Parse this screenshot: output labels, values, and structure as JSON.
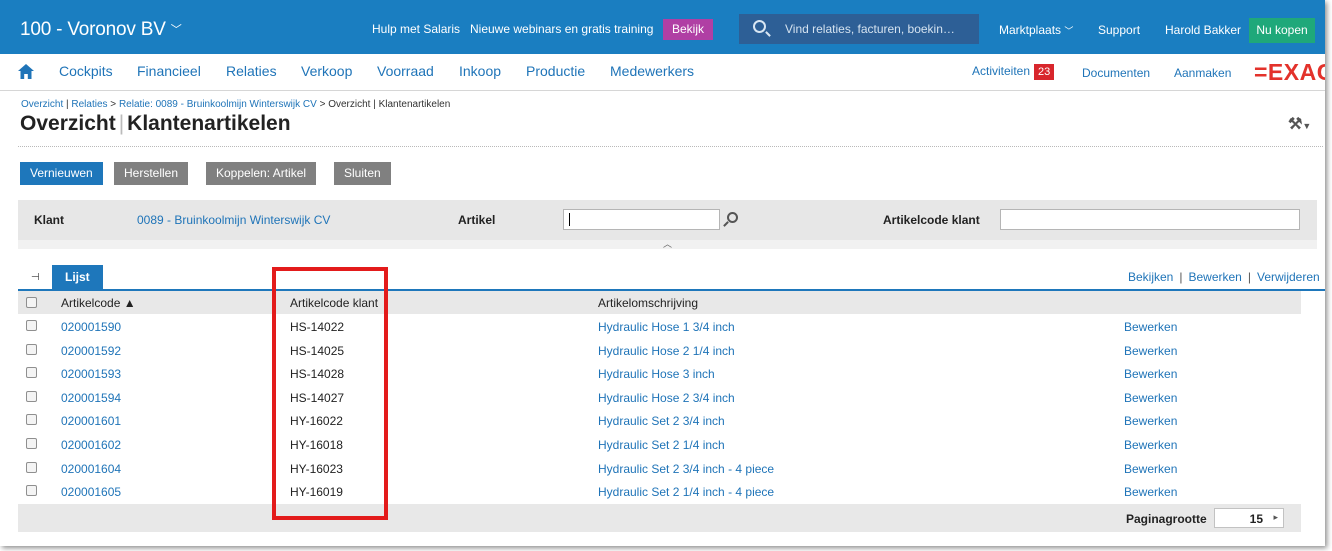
{
  "topbar": {
    "company": "100 - Voronov BV",
    "promo_salaris": "Hulp met Salaris",
    "promo_webinar": "Nieuwe webinars en gratis training",
    "bekijk": "Bekijk",
    "search_placeholder": "Vind relaties, facturen, boekin…",
    "marktplaats": "Marktplaats",
    "support": "Support",
    "user": "Harold Bakker",
    "buy_now": "Nu kopen"
  },
  "nav": {
    "items": [
      "Cockpits",
      "Financieel",
      "Relaties",
      "Verkoop",
      "Voorraad",
      "Inkoop",
      "Productie",
      "Medewerkers"
    ],
    "activiteiten": "Activiteiten",
    "activiteiten_count": "23",
    "documenten": "Documenten",
    "aanmaken": "Aanmaken",
    "logo": "=EXAC"
  },
  "breadcrumb": {
    "items": [
      "Overzicht",
      "Relaties",
      "Relatie: 0089 - Bruinkoolmijn Winterswijk CV"
    ],
    "current": "Overzicht | Klantenartikelen"
  },
  "title": {
    "part1": "Overzicht",
    "part2": "Klantenartikelen"
  },
  "buttons": {
    "vernieuwen": "Vernieuwen",
    "herstellen": "Herstellen",
    "koppelen": "Koppelen: Artikel",
    "sluiten": "Sluiten"
  },
  "filter": {
    "klant_label": "Klant",
    "klant_value": "0089 - Bruinkoolmijn Winterswijk CV",
    "artikel_label": "Artikel",
    "artikel_value": "",
    "artikelcode_klant_label": "Artikelcode klant",
    "artikelcode_klant_value": ""
  },
  "tabs": {
    "lijst": "Lijst",
    "actions": [
      "Bekijken",
      "Bewerken",
      "Verwijderen"
    ]
  },
  "table": {
    "columns": [
      "Artikelcode ▲",
      "Artikelcode klant",
      "Artikelomschrijving"
    ],
    "rows": [
      {
        "code": "020001590",
        "klant": "HS-14022",
        "omschrijving": "Hydraulic Hose 1 3/4 inch",
        "action": "Bewerken"
      },
      {
        "code": "020001592",
        "klant": "HS-14025",
        "omschrijving": "Hydraulic Hose 2 1/4 inch",
        "action": "Bewerken"
      },
      {
        "code": "020001593",
        "klant": "HS-14028",
        "omschrijving": "Hydraulic Hose 3 inch",
        "action": "Bewerken"
      },
      {
        "code": "020001594",
        "klant": "HS-14027",
        "omschrijving": "Hydraulic Hose 2 3/4 inch",
        "action": "Bewerken"
      },
      {
        "code": "020001601",
        "klant": "HY-16022",
        "omschrijving": "Hydraulic Set 2 3/4 inch",
        "action": "Bewerken"
      },
      {
        "code": "020001602",
        "klant": "HY-16018",
        "omschrijving": "Hydraulic Set 2 1/4 inch",
        "action": "Bewerken"
      },
      {
        "code": "020001604",
        "klant": "HY-16023",
        "omschrijving": "Hydraulic Set 2 3/4 inch - 4 piece",
        "action": "Bewerken"
      },
      {
        "code": "020001605",
        "klant": "HY-16019",
        "omschrijving": "Hydraulic Set 2 1/4 inch - 4 piece",
        "action": "Bewerken"
      }
    ]
  },
  "pagination": {
    "label": "Paginagrootte",
    "value": "15"
  },
  "colors": {
    "brand_blue": "#1a7ec1",
    "link_blue": "#1f74b8",
    "bekijk_purple": "#b03fa4",
    "buy_green": "#1fa87a",
    "highlight_red": "#e31b1b"
  }
}
